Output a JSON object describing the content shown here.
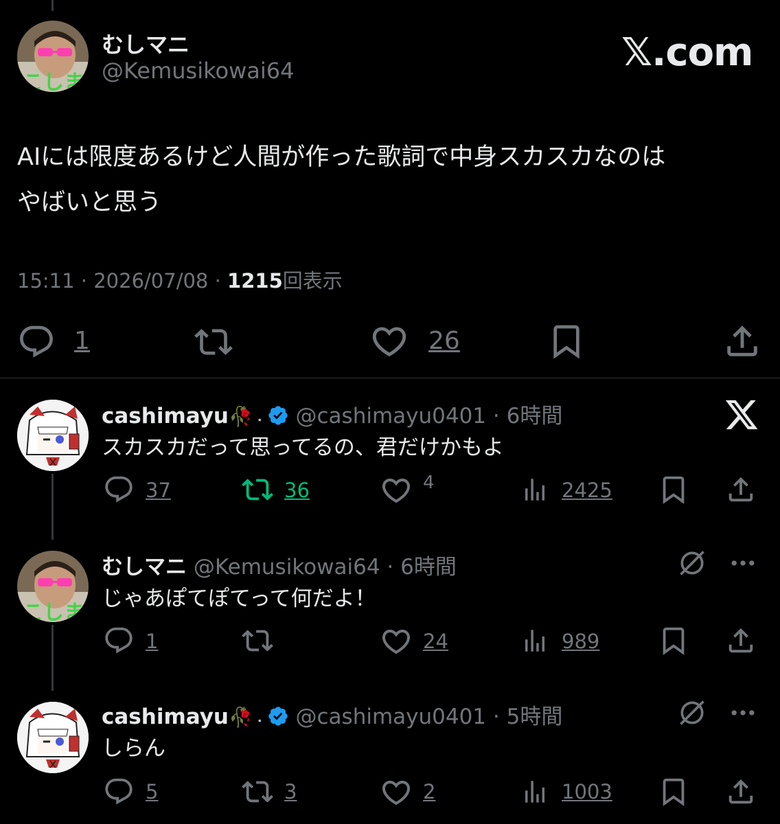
{
  "main_post": {
    "display_name": "むしマニ",
    "handle": "@Kemusikowai64",
    "brand": "𝕏.com",
    "text_line1": "AIには限度あるけど人間が作った歌詞で中身スカスカなのは",
    "text_line2": "やばいと思う",
    "time": "15:11",
    "date": "2026/07/08",
    "views": "1215",
    "views_suffix": "回表示",
    "sep": "·",
    "replies": "1",
    "likes": "26"
  },
  "replies": [
    {
      "display_name": "cashimayu",
      "handle": "@cashimayu0401",
      "sep": "·",
      "age": "6時間",
      "text": "スカスカだって思ってるの、君だけかもよ",
      "replies": "37",
      "reposts": "36",
      "likes": "4",
      "views": "2425",
      "verified": true,
      "avatar_icon": "anime-girl-avatar"
    },
    {
      "display_name": "むしマニ",
      "handle": "@Kemusikowai64",
      "sep": "·",
      "age": "6時間",
      "text": "じゃあぽてぽてって何だよ！",
      "replies": "1",
      "reposts": "",
      "likes": "24",
      "views": "989",
      "verified": false,
      "avatar_icon": "sunglasses-man-avatar"
    },
    {
      "display_name": "cashimayu",
      "handle": "@cashimayu0401",
      "sep": "·",
      "age": "5時間",
      "text": "しらん",
      "replies": "5",
      "reposts": "3",
      "likes": "2",
      "views": "1003",
      "verified": true,
      "avatar_icon": "anime-girl-avatar"
    }
  ],
  "colors": {
    "background": "#000000",
    "text": "#e7e9ea",
    "muted": "#71767b",
    "verified": "#1d9bf0",
    "repost_active": "#00ba7c"
  }
}
